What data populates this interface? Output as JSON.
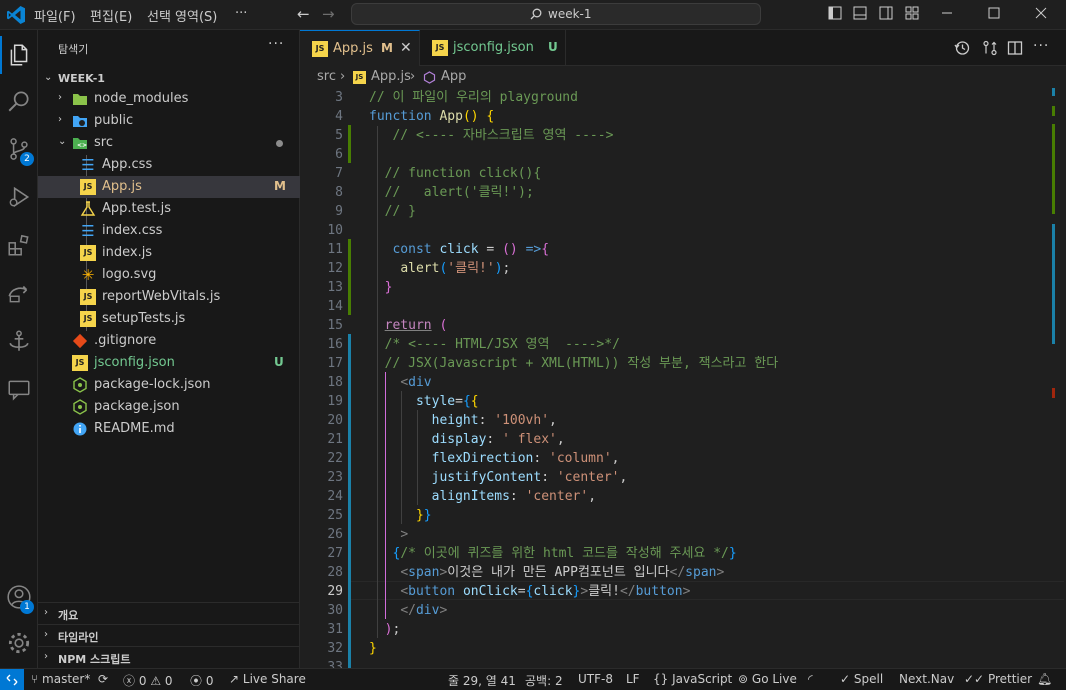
{
  "menu": {
    "file": "파일(F)",
    "edit": "편집(E)",
    "selection": "선택 영역(S)",
    "more": "···"
  },
  "search": {
    "text": "week-1"
  },
  "activity": {
    "scm_badge": "2",
    "account_badge": "1"
  },
  "explorer": {
    "title": "탐색기",
    "more": "···",
    "root": "WEEK-1",
    "items": [
      {
        "name": "node_modules",
        "type": "folder"
      },
      {
        "name": "public",
        "type": "folder"
      },
      {
        "name": "src",
        "type": "folder-open"
      },
      {
        "name": "App.css",
        "type": "css"
      },
      {
        "name": "App.js",
        "type": "js",
        "status": "M"
      },
      {
        "name": "App.test.js",
        "type": "test"
      },
      {
        "name": "index.css",
        "type": "css"
      },
      {
        "name": "index.js",
        "type": "js"
      },
      {
        "name": "logo.svg",
        "type": "svg"
      },
      {
        "name": "reportWebVitals.js",
        "type": "js"
      },
      {
        "name": "setupTests.js",
        "type": "js"
      },
      {
        "name": ".gitignore",
        "type": "git"
      },
      {
        "name": "jsconfig.json",
        "type": "json",
        "status": "U"
      },
      {
        "name": "package-lock.json",
        "type": "npm"
      },
      {
        "name": "package.json",
        "type": "npm"
      },
      {
        "name": "README.md",
        "type": "info"
      }
    ],
    "panels": [
      "개요",
      "타임라인",
      "NPM 스크립트"
    ]
  },
  "tabs": [
    {
      "name": "App.js",
      "status": "M",
      "close": "✕"
    },
    {
      "name": "jsconfig.json",
      "status": "U"
    }
  ],
  "breadcrumb": {
    "folder": "src",
    "file": "App.js",
    "symbol": "App"
  },
  "editor": {
    "line_numbers": [
      "3",
      "4",
      "5",
      "6",
      "7",
      "8",
      "9",
      "10",
      "11",
      "12",
      "13",
      "14",
      "15",
      "16",
      "17",
      "18",
      "19",
      "20",
      "21",
      "22",
      "23",
      "24",
      "25",
      "26",
      "27",
      "28",
      "29",
      "30",
      "31",
      "32",
      "33"
    ],
    "current_line": "29"
  },
  "status": {
    "branch": "master*",
    "errors": "0",
    "warnings": "0",
    "ports": "0",
    "live_share": "Live Share",
    "position": "줄 29, 열 41",
    "spaces": "공백: 2",
    "encoding": "UTF-8",
    "eol": "LF",
    "language": "JavaScript",
    "go_live": "Go Live",
    "spell": "Spell",
    "nextnav": "Next.Nav",
    "prettier": "Prettier"
  },
  "colors": {
    "accent": "#0078d4",
    "modified": "#e2c08d",
    "untracked": "#73c991"
  }
}
